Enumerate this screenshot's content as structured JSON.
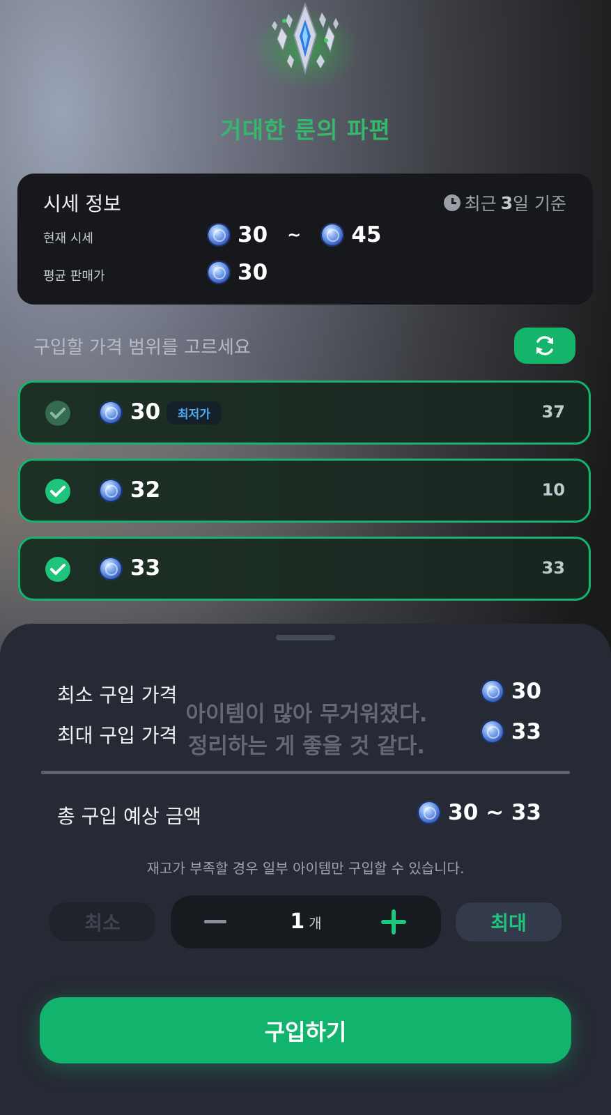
{
  "item": {
    "name": "거대한 룬의 파편",
    "title_color": "#35b86b"
  },
  "price_info": {
    "title": "시세 정보",
    "period_prefix": "최근",
    "period_number": "3",
    "period_suffix": "일 기준",
    "current_label": "현재 시세",
    "current_min": "30",
    "current_max": "45",
    "range_sep": "~",
    "average_label": "평균 판매가",
    "average_value": "30"
  },
  "choose_label": "구입할 가격 범위를 고르세요",
  "price_rows": [
    {
      "price": "30",
      "badge": "최저가",
      "quantity": "37",
      "checked": true
    },
    {
      "price": "32",
      "badge": "",
      "quantity": "10",
      "checked": true
    },
    {
      "price": "33",
      "badge": "",
      "quantity": "33",
      "checked": true
    }
  ],
  "sheet": {
    "min_price_label": "최소 구입 가격",
    "min_price_value": "30",
    "max_price_label": "최대 구입 가격",
    "max_price_value": "33",
    "toast_line1": "아이템이 많아 무거워졌다.",
    "toast_line2": "정리하는 게 좋을 것 같다.",
    "total_label": "총 구입 예상 금액",
    "total_value": "30 ~ 33",
    "note": "재고가 부족할 경우 일부 아이템만 구입할 수 있습니다.",
    "min_button": "최소",
    "quantity": "1",
    "quantity_unit": "개",
    "max_button": "최대",
    "buy_button": "구입하기"
  },
  "icons": [
    "rune-shard-icon",
    "clock-icon",
    "currency-coin-icon",
    "refresh-icon",
    "checkmark-icon",
    "minus-icon",
    "plus-icon"
  ],
  "colors": {
    "accent_green": "#14b56b",
    "badge_blue": "#4ea9f3",
    "sheet_bg": "#262a34"
  }
}
